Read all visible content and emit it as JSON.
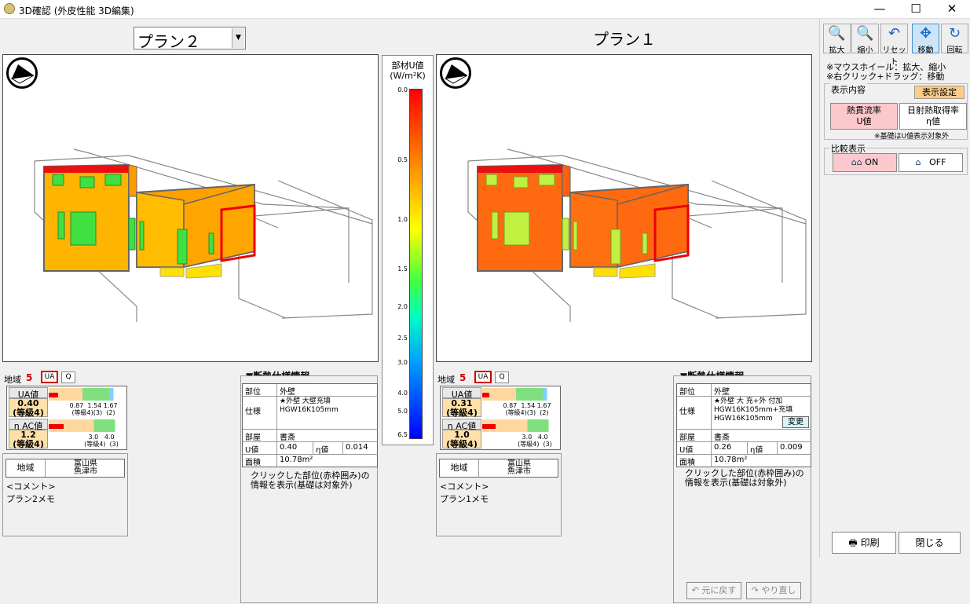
{
  "window": {
    "title": "3D確認 (外皮性能 3D編集)",
    "minimize": "—",
    "maximize": "☐",
    "close": "✕"
  },
  "left": {
    "plan_select": "プラン２",
    "area_label": "地域",
    "area_no": "5",
    "ua_btn": "UA",
    "q_btn": "Q",
    "ua_label": "UA値",
    "ua_value": "0.40",
    "ua_grade": "(等級4)",
    "ua_scale": [
      "0.87",
      "1.54",
      "1.67"
    ],
    "ua_scale_sub": [
      "(等級4)",
      "(3)",
      "(2)"
    ],
    "ua_fill": 0.12,
    "ac_label": "η AC値",
    "ac_value": "1.2",
    "ac_grade": "(等級4)",
    "ac_scale": [
      "3.0",
      "4.0"
    ],
    "ac_scale_sub": [
      "(等級4)",
      "(3)"
    ],
    "ac_fill": 0.2,
    "loc_label": "地域",
    "loc_pref": "富山県",
    "loc_city": "魚津市",
    "comment_label": "<コメント>",
    "comment": "プラン2メモ",
    "info_title": "▼断熱仕様情報",
    "part_label": "部位",
    "part": "外壁",
    "spec_label": "仕様",
    "spec": "★外壁 大壁充填 HGW16K105mm",
    "room_label": "部屋",
    "room": "書斎",
    "u_label": "U値",
    "u": "0.40",
    "eta_label": "η値",
    "eta": "0.014",
    "area_lbl": "面積",
    "area": "10.78m²",
    "note": "クリックした部位(赤枠囲み)の情報を表示(基礎は対象外)"
  },
  "right": {
    "plan_title": "プラン１",
    "area_label": "地域",
    "area_no": "5",
    "ua_btn": "UA",
    "q_btn": "Q",
    "ua_label": "UA値",
    "ua_value": "0.31",
    "ua_grade": "(等級4)",
    "ua_scale": [
      "0.87",
      "1.54",
      "1.67"
    ],
    "ua_scale_sub": [
      "(等級4)",
      "(3)",
      "(2)"
    ],
    "ua_fill": 0.09,
    "ac_label": "η AC値",
    "ac_value": "1.0",
    "ac_grade": "(等級4)",
    "ac_scale": [
      "3.0",
      "4.0"
    ],
    "ac_scale_sub": [
      "(等級4)",
      "(3)"
    ],
    "ac_fill": 0.18,
    "loc_label": "地域",
    "loc_pref": "富山県",
    "loc_city": "魚津市",
    "comment_label": "<コメント>",
    "comment": "プラン1メモ",
    "info_title": "▼断熱仕様情報",
    "part_label": "部位",
    "part": "外壁",
    "spec_label": "仕様",
    "spec": "★外壁 大 充+外 付加HGW16K105mm+充填HGW16K105mm",
    "change_btn": "変更",
    "room_label": "部屋",
    "room": "書斎",
    "u_label": "U値",
    "u": "0.26",
    "eta_label": "η値",
    "eta": "0.009",
    "area_lbl": "面積",
    "area": "10.78m²",
    "note": "クリックした部位(赤枠囲み)の情報を表示(基礎は対象外)",
    "undo": "元に戻す",
    "redo": "やり直し"
  },
  "legend": {
    "title1": "部材U値",
    "title2": "(W/m²K)",
    "ticks": [
      "0.0",
      "0.5",
      "1.0",
      "1.5",
      "2.0",
      "2.5",
      "3.0",
      "4.0",
      "5.0",
      "6.5"
    ]
  },
  "tools": [
    {
      "label": "拡大",
      "icon": "🔍"
    },
    {
      "label": "縮小",
      "icon": "🔍"
    },
    {
      "label": "リセット",
      "icon": "↶"
    },
    {
      "label": "移動",
      "icon": "✥"
    },
    {
      "label": "回転",
      "icon": "↻"
    }
  ],
  "hints": [
    "※マウスホイール：拡大、縮小",
    "※右クリック+ドラッグ：移動"
  ],
  "display": {
    "group": "表示内容",
    "settings_btn": "表示設定",
    "u_btn1": "熱貫流率",
    "u_btn2": "U値",
    "eta_btn1": "日射熱取得率",
    "eta_btn2": "η値",
    "note": "※基礎はU値表示対象外"
  },
  "compare": {
    "group": "比較表示",
    "on": "ON",
    "off": "OFF"
  },
  "print_btn": "印刷",
  "close_btn": "閉じる"
}
